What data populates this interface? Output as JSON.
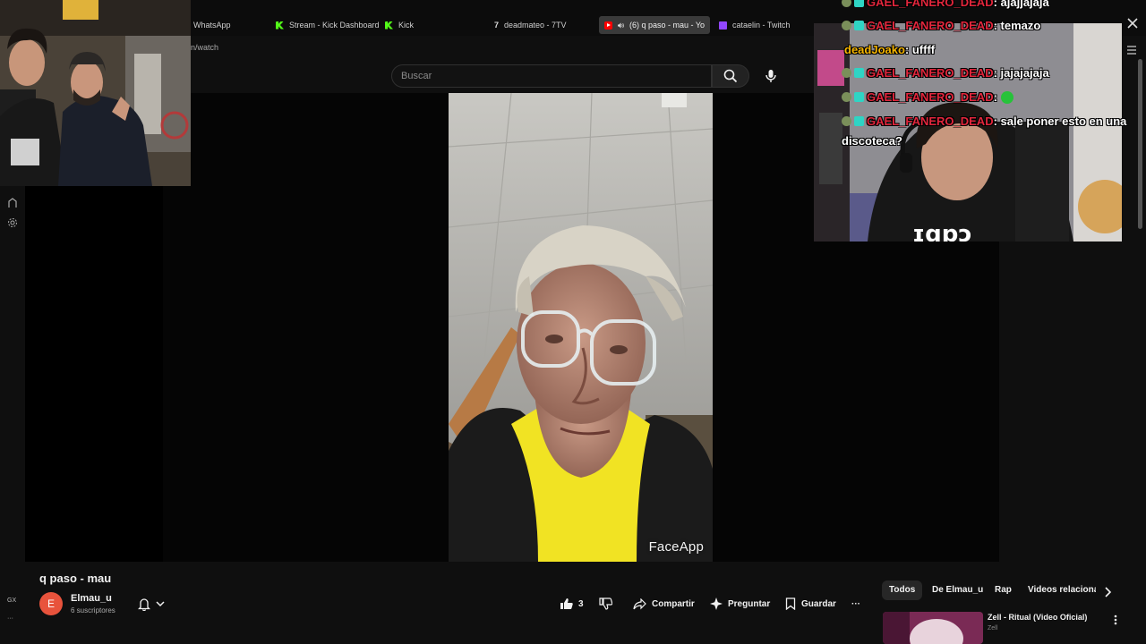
{
  "browser": {
    "tabs": [
      {
        "label": "WhatsApp",
        "icon": "whatsapp-icon"
      },
      {
        "label": "Stream - Kick Dashboard",
        "icon": "kick-icon"
      },
      {
        "label": "Kick",
        "icon": "kick-icon"
      },
      {
        "label": "deadmateo - 7TV",
        "icon": "seventv-icon"
      },
      {
        "label": "(6) q paso - mau - Yo",
        "icon": "youtube-icon",
        "active": true
      },
      {
        "label": "cataelin - Twitch",
        "icon": "twitch-icon"
      }
    ],
    "url_partial": "n/watch",
    "seventv_glyph": "7"
  },
  "youtube": {
    "search_placeholder": "Buscar",
    "video_watermark": "FaceApp",
    "video_title": "q paso - mau",
    "channel": {
      "avatar_letter": "E",
      "avatar_color": "#e8533c",
      "name": "Elmau_u",
      "subscribers": "6 suscriptores"
    },
    "actions": {
      "like_count": "3",
      "share": "Compartir",
      "ask": "Preguntar",
      "save": "Guardar",
      "more": "···"
    },
    "chips": [
      {
        "label": "Todos",
        "active": true
      },
      {
        "label": "De Elmau_u"
      },
      {
        "label": "Rap"
      },
      {
        "label": "Videos relaciona"
      }
    ],
    "recommendation": {
      "title": "Zell - Ritual (Video Oficial)",
      "channel": "Zell"
    },
    "sidebar_bottom_label": "GX"
  },
  "chat": {
    "messages": [
      {
        "user": "GAEL_FANERO_DEAD",
        "text": ": ajajjajaja",
        "user_color": "#e2263c"
      },
      {
        "user": "GAEL_FANERO_DEAD",
        "text": ": temazo",
        "user_color": "#e2263c"
      },
      {
        "user": "deadJoako",
        "text": ": uffff",
        "user_color": "#f4b400"
      },
      {
        "user": "GAEL_FANERO_DEAD",
        "text": ": jajajajaja",
        "user_color": "#e2263c"
      },
      {
        "user": "GAEL_FANERO_DEAD",
        "text": ":",
        "user_color": "#e2263c",
        "emote": true
      },
      {
        "user": "GAEL_FANERO_DEAD",
        "text": ": sale poner esto en una",
        "user_color": "#e2263c"
      }
    ],
    "wrap_line": "discoteca?"
  }
}
